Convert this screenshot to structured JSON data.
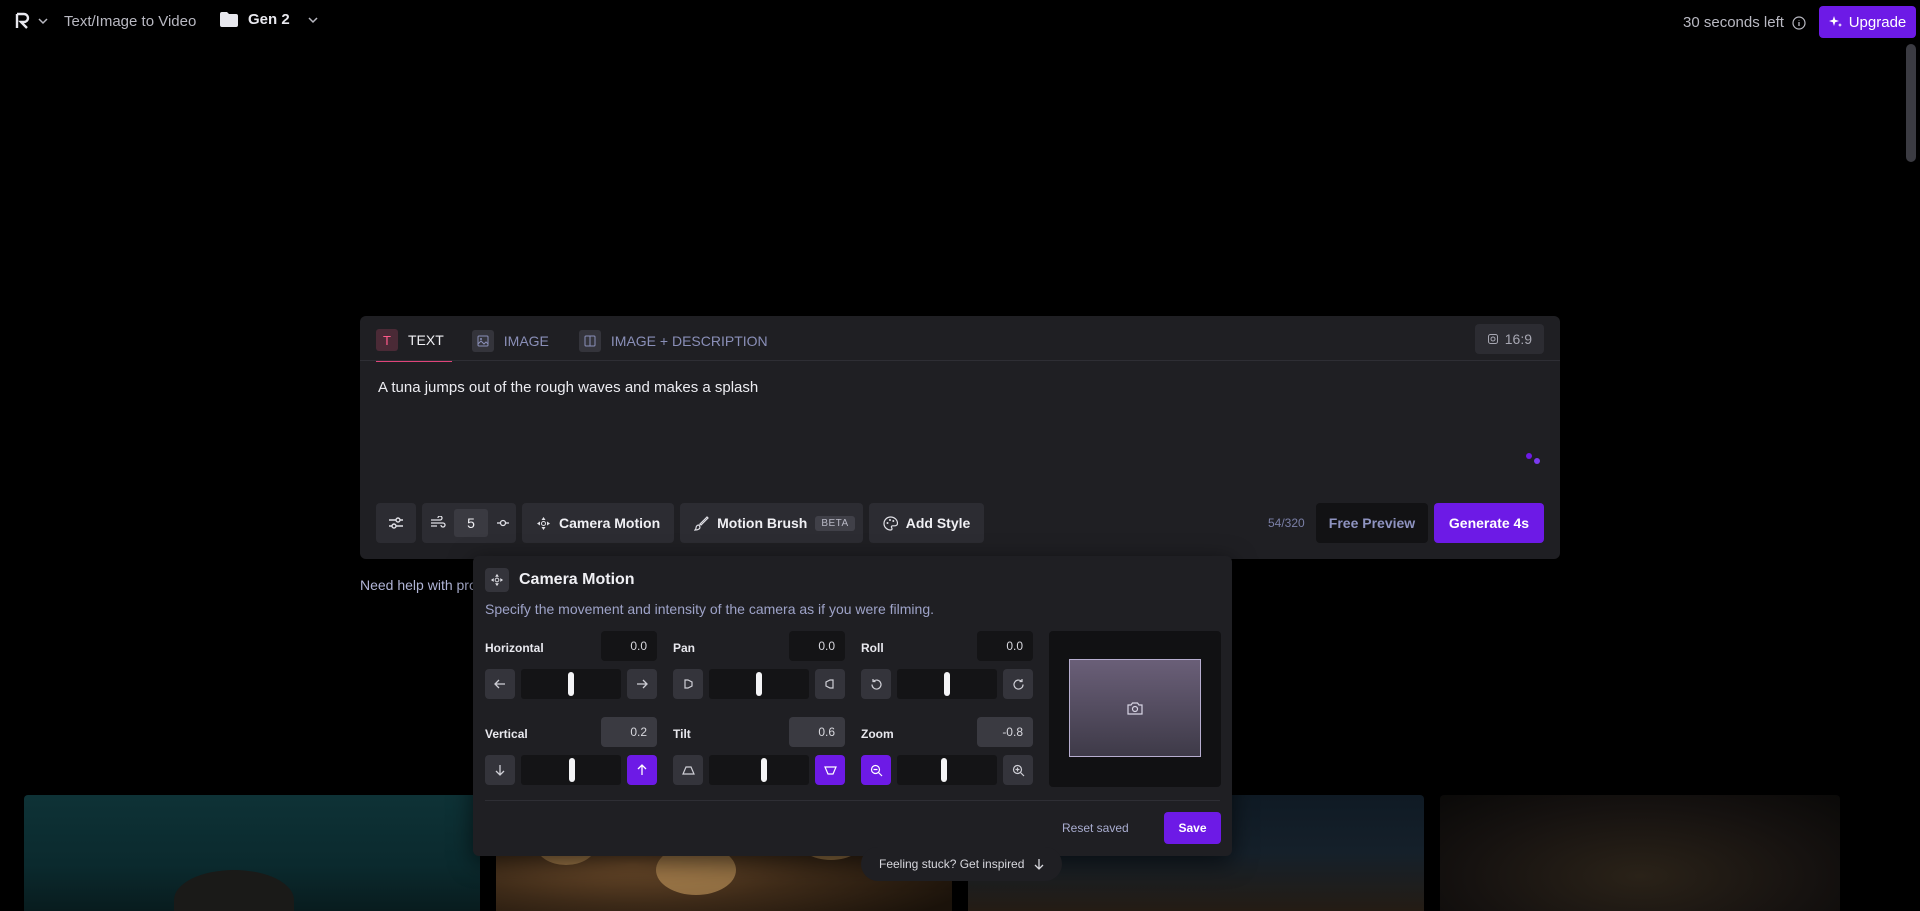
{
  "header": {
    "crumb": "Text/Image to Video",
    "folder": "Gen 2",
    "time_left": "30 seconds left",
    "upgrade": "Upgrade"
  },
  "prompt": {
    "tabs": [
      {
        "label": "TEXT",
        "icon": "text-icon",
        "active": true
      },
      {
        "label": "IMAGE",
        "icon": "image-icon",
        "active": false
      },
      {
        "label": "IMAGE + DESCRIPTION",
        "icon": "image-description-icon",
        "active": false
      }
    ],
    "aspect_ratio": "16:9",
    "text": "A tuna jumps out of the rough waves and makes a splash",
    "motion_value": "5",
    "camera_motion": "Camera Motion",
    "motion_brush": "Motion Brush",
    "beta": "BETA",
    "add_style": "Add Style",
    "char_count": "54/320",
    "free_preview": "Free Preview",
    "generate": "Generate 4s"
  },
  "help": "Need help with pro",
  "camera_panel": {
    "title": "Camera Motion",
    "description": "Specify the movement and intensity of the camera as if you were filming.",
    "controls": {
      "horizontal": {
        "label": "Horizontal",
        "value": "0.0"
      },
      "pan": {
        "label": "Pan",
        "value": "0.0"
      },
      "roll": {
        "label": "Roll",
        "value": "0.0"
      },
      "vertical": {
        "label": "Vertical",
        "value": "0.2"
      },
      "tilt": {
        "label": "Tilt",
        "value": "0.6"
      },
      "zoom": {
        "label": "Zoom",
        "value": "-0.8"
      }
    },
    "reset": "Reset saved",
    "save": "Save"
  },
  "inspired": "Feeling stuck? Get inspired",
  "colors": {
    "accent": "#6d1ae6",
    "panel": "#1f1f23",
    "tab_active": "#e0447a"
  }
}
